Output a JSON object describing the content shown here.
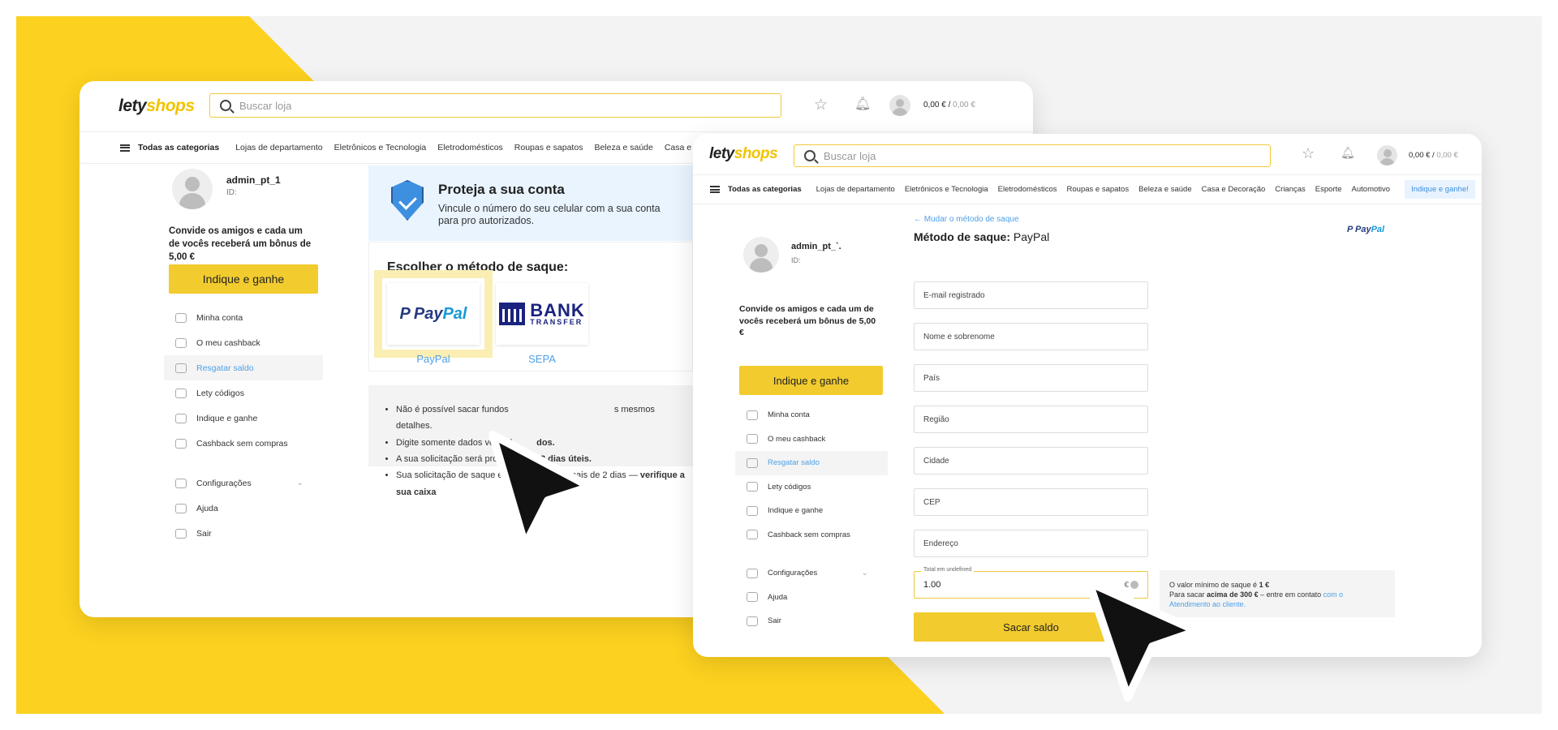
{
  "brand": {
    "logo_part1": "lety",
    "logo_part2": "shops"
  },
  "header": {
    "search_placeholder": "Buscar loja",
    "balance_main": "0,00 € /",
    "balance_pending": " 0,00 €"
  },
  "categories": {
    "all_label": "Todas as categorias",
    "items": [
      "Lojas de departamento",
      "Eletrônicos e Tecnologia",
      "Eletrodomésticos",
      "Roupas e sapatos",
      "Beleza e saúde",
      "Casa e Decoração",
      "Crianças",
      "Esporte",
      "Automotivo"
    ],
    "refer_tab": "Indique e ganhe!"
  },
  "profile": {
    "username_back": "admin_pt_1",
    "username_front": "admin_pt_`.",
    "id_label": "ID:",
    "invite_text": "Convide os amigos e cada um de vocês receberá um bônus de 5,00 €",
    "invite_button": "Indique e ganhe"
  },
  "sidebar": {
    "items": [
      "Minha conta",
      "O meu cashback",
      "Resgatar saldo",
      "Lety códigos",
      "Indique e ganhe",
      "Cashback sem compras"
    ],
    "settings": "Configurações",
    "help": "Ajuda",
    "logout": "Sair"
  },
  "protect": {
    "title": "Proteja a sua conta",
    "description": "Vincule o número do seu celular com a sua conta para pro autorizados."
  },
  "methods": {
    "title": "Escolher o método de saque:",
    "paypal_label": "PayPal",
    "sepa_label": "SEPA",
    "paypal_logo_a": "Pay",
    "paypal_logo_b": "Pal",
    "bank_logo_a": "BANK",
    "bank_logo_b": "TRANSFER"
  },
  "notes": {
    "n1_a": "Não é possível sacar fundos",
    "n1_b": "s mesmos detalhes.",
    "n2_a": "Digite somente dados verdad",
    "n2_b": "dos.",
    "n3_a": "A sua solicitação será process",
    "n3_b": "3 dias úteis.",
    "n4_a": "Sua solicitação de saque está p",
    "n4_b": "te há mais de 2 dias —",
    "n4_c": "verifique a sua caixa"
  },
  "form": {
    "back_link": "← Mudar o método de saque",
    "title_bold": "Método de saque:",
    "title_value": "PayPal",
    "fields": [
      "E-mail registrado",
      "Nome e sobrenome",
      "País",
      "Região",
      "Cidade",
      "CEP",
      "Endereço"
    ],
    "amount_label": "Total em undefined",
    "amount_value": "1.00",
    "amount_currency": "€",
    "submit": "Sacar saldo",
    "info_line1_a": "O valor mínimo de saque é",
    "info_line1_b": "1 €",
    "info_line2_a": "Para sacar",
    "info_line2_b": "acima de 300 €",
    "info_line2_c": "– entre em contato",
    "info_line2_link": "com o Atendimento ao cliente."
  },
  "colors": {
    "yellow": "#fcd11f",
    "accent_blue": "#4ea0e8",
    "button_yellow": "#f2cb2e"
  }
}
